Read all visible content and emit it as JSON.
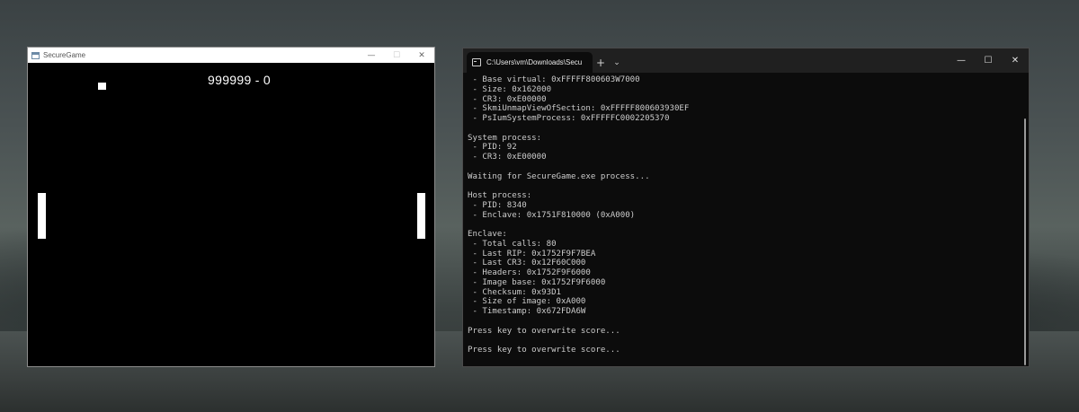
{
  "game": {
    "title": "SecureGame",
    "score": "999999 - 0"
  },
  "terminal": {
    "tab_title": "C:\\Users\\vm\\Downloads\\Secu",
    "add_tab": "+",
    "dropdown": "⌄",
    "lines": [
      " - Base virtual: 0xFFFFF800603W7000",
      " - Size: 0x162000",
      " - CR3: 0xE00000",
      " - SkmiUnmapViewOfSection: 0xFFFFF800603930EF",
      " - PsIumSystemProcess: 0xFFFFFC0002205370",
      "",
      "System process:",
      " - PID: 92",
      " - CR3: 0xE00000",
      "",
      "Waiting for SecureGame.exe process...",
      "",
      "Host process:",
      " - PID: 8340",
      " - Enclave: 0x1751F810000 (0xA000)",
      "",
      "Enclave:",
      " - Total calls: 80",
      " - Last RIP: 0x1752F9F7BEA",
      " - Last CR3: 0x12F60C000",
      " - Headers: 0x1752F9F6000",
      " - Image base: 0x1752F9F6000",
      " - Checksum: 0x93D1",
      " - Size of image: 0xA000",
      " - Timestamp: 0x672FDA6W",
      "",
      "Press key to overwrite score...",
      "",
      "Press key to overwrite score..."
    ]
  },
  "window_buttons": {
    "minimize": "—",
    "maximize": "☐",
    "close": "✕"
  }
}
